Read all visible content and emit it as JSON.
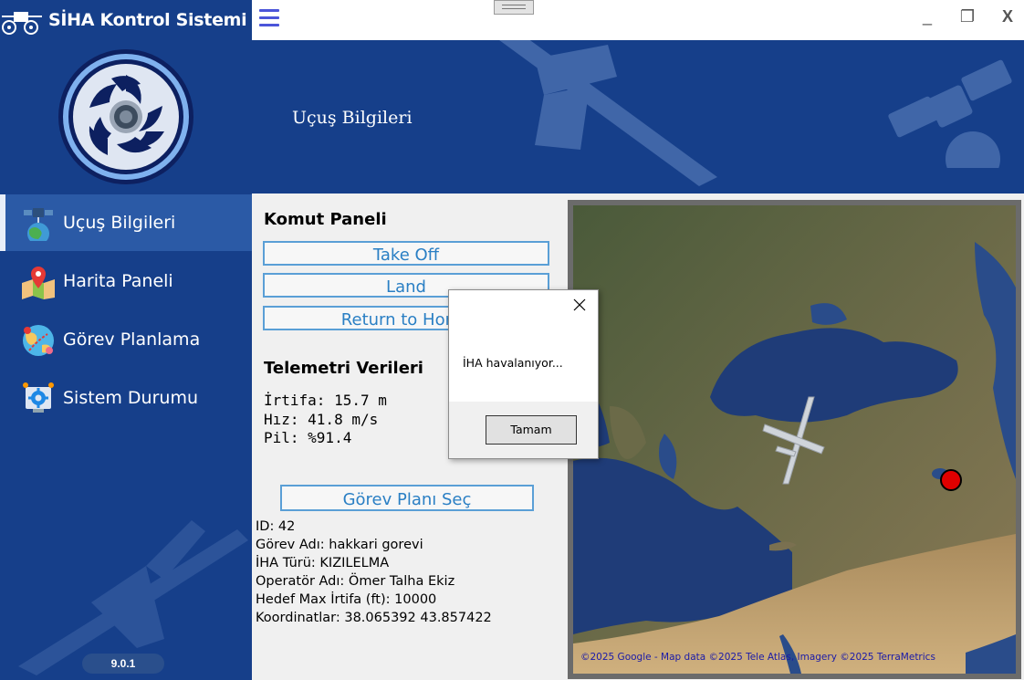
{
  "app": {
    "title": "SİHA Kontrol Sistemi",
    "version": "9.0.1"
  },
  "window_controls": {
    "minimize": "_",
    "maximize": "❐",
    "close": "X"
  },
  "sidebar": {
    "items": [
      {
        "label": "Uçuş Bilgileri",
        "icon": "satellite-earth-icon",
        "active": true
      },
      {
        "label": "Harita Paneli",
        "icon": "map-pin-icon",
        "active": false
      },
      {
        "label": "Görev Planlama",
        "icon": "globe-route-icon",
        "active": false
      },
      {
        "label": "Sistem Durumu",
        "icon": "system-gear-icon",
        "active": false
      }
    ]
  },
  "banner": {
    "title": "Uçuş Bilgileri"
  },
  "command_panel": {
    "title": "Komut Paneli",
    "buttons": [
      "Take Off",
      "Land",
      "Return to Home"
    ]
  },
  "telemetry": {
    "title": "Telemetri Verileri",
    "lines": [
      "İrtifa: 15.7 m",
      "Hız: 41.8 m/s",
      "Pil: %91.4"
    ]
  },
  "mission": {
    "select_button": "Görev Planı Seç",
    "info": [
      "ID: 42",
      "Görev Adı: hakkari gorevi",
      "İHA Türü: KIZILELMA",
      "Operatör Adı: Ömer Talha Ekiz",
      "Hedef Max İrtifa (ft): 10000",
      "Koordinatlar: 38.065392 43.857422"
    ]
  },
  "map": {
    "credit": "©2025 Google - Map data ©2025 Tele Atlas, Imagery ©2025 TerraMetrics"
  },
  "dialog": {
    "message": "İHA havalanıyor...",
    "ok_label": "Tamam"
  },
  "colors": {
    "sidebar_bg": "#163f8a",
    "active_item": "#2b5aa6",
    "button_border": "#5a9fd6",
    "button_text": "#2a7fc4",
    "target_marker": "#e00000"
  }
}
